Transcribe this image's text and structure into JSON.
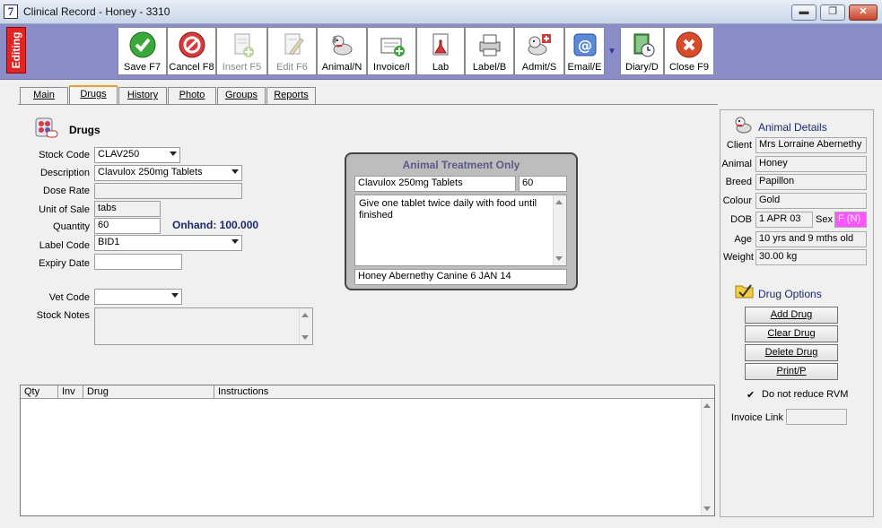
{
  "window": {
    "title": "Clinical Record - Honey - 3310",
    "app_icon_glyph": "7",
    "minimize_glyph": "▬",
    "restore_glyph": "❐",
    "close_glyph": "✕"
  },
  "editing_tag": "Editing",
  "toolbar": {
    "save": "Save F7",
    "cancel": "Cancel F8",
    "insert": "Insert F5",
    "edit": "Edit F6",
    "animal": "Animal/N",
    "invoice": "Invoice/I",
    "lab": "Lab",
    "label": "Label/B",
    "admit": "Admit/S",
    "email": "Email/E",
    "diary": "Diary/D",
    "close": "Close F9",
    "email_dropdown_glyph": "▼"
  },
  "tabs": [
    "Main",
    "Drugs",
    "History",
    "Photo",
    "Groups",
    "Reports"
  ],
  "drugs_section": {
    "heading": "Drugs",
    "stock_code_label": "Stock Code",
    "stock_code_value": "CLAV250",
    "description_label": "Description",
    "description_value": "Clavulox 250mg Tablets",
    "dose_rate_label": "Dose Rate",
    "dose_rate_value": "",
    "unit_of_sale_label": "Unit of Sale",
    "unit_of_sale_value": "tabs",
    "quantity_label": "Quantity",
    "quantity_value": "60",
    "onhand_text": "Onhand: 100.000",
    "label_code_label": "Label Code",
    "label_code_value": "BID1",
    "expiry_date_label": "Expiry Date",
    "expiry_date_value": "",
    "vet_code_label": "Vet Code",
    "vet_code_value": "",
    "stock_notes_label": "Stock Notes",
    "stock_notes_value": ""
  },
  "treatment": {
    "title": "Animal Treatment Only",
    "drug_name": "Clavulox 250mg Tablets",
    "quantity": "60",
    "instructions": "Give one tablet twice daily with food until finished",
    "footer": "Honey Abernethy  Canine 6 JAN 14"
  },
  "animal_details": {
    "heading": "Animal Details",
    "client_label": "Client",
    "client_value": "Mrs Lorraine Abernethy",
    "animal_label": "Animal",
    "animal_value": "Honey",
    "breed_label": "Breed",
    "breed_value": "Papillon",
    "colour_label": "Colour",
    "colour_value": "Gold",
    "dob_label": "DOB",
    "dob_value": "1 APR 03",
    "sex_label": "Sex",
    "sex_value": "F (N)",
    "sex_color": "#ff55ff",
    "age_label": "Age",
    "age_value": "10 yrs and 9 mths old",
    "weight_label": "Weight",
    "weight_value": "30.00 kg"
  },
  "drug_options": {
    "heading": "Drug Options",
    "add": "Add Drug",
    "clear": "Clear Drug",
    "delete": "Delete Drug",
    "print": "Print/P",
    "do_not_reduce_label": "Do not reduce RVM",
    "do_not_reduce_checked": true,
    "checkmark_glyph": "✔",
    "invoice_link_label": "Invoice Link",
    "invoice_link_value": ""
  },
  "grid": {
    "columns": [
      "Qty",
      "Inv",
      "Drug",
      "Instructions"
    ],
    "rows": []
  }
}
